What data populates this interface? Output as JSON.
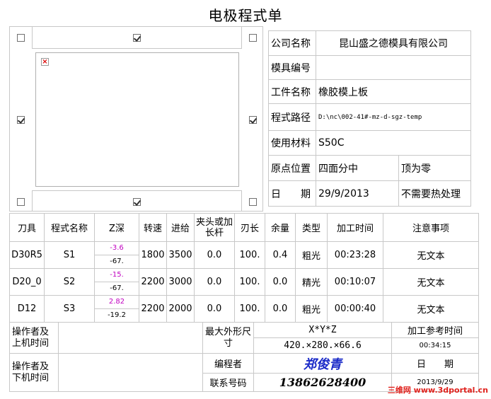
{
  "title": "电极程式单",
  "info": {
    "rows": [
      {
        "label": "公司名称",
        "value": "昆山盛之德模具有限公司"
      },
      {
        "label": "模具编号",
        "value": ""
      },
      {
        "label": "工件名称",
        "value": "橡胶模上板"
      },
      {
        "label": "程式路径",
        "value": "D:\\nc\\002-41#-mz-d-sgz-temp"
      },
      {
        "label": "使用材料",
        "value": "S50C"
      },
      {
        "label": "原点位置",
        "value": "四面分中",
        "extra": "顶为零"
      },
      {
        "label": "日　　期",
        "value": "29/9/2013",
        "extra": "不需要热处理"
      }
    ]
  },
  "headers": [
    "刀具",
    "程式名称",
    "Z深",
    "转速",
    "进给",
    "夹头或加长杆",
    "刃长",
    "余量",
    "类型",
    "加工时间",
    "注意事项"
  ],
  "rows": [
    {
      "tool": "D30R5",
      "prog": "S1",
      "z_top": "-3.6",
      "z_bot": "-67.",
      "speed": "1800",
      "feed": "3500",
      "chuck": "0.0",
      "blade": "100.",
      "allow": "0.4",
      "type": "粗光",
      "time": "00:23:28",
      "note": "无文本"
    },
    {
      "tool": "D20_0",
      "prog": "S2",
      "z_top": "-15.",
      "z_bot": "-67.",
      "speed": "2200",
      "feed": "3000",
      "chuck": "0.0",
      "blade": "100.",
      "allow": "0.0",
      "type": "精光",
      "time": "00:10:07",
      "note": "无文本"
    },
    {
      "tool": "D12",
      "prog": "S3",
      "z_top": "2.82",
      "z_bot": "-19.2",
      "speed": "2200",
      "feed": "2000",
      "chuck": "0.0",
      "blade": "100.",
      "allow": "0.0",
      "type": "粗光",
      "time": "00:00:40",
      "note": "无文本"
    }
  ],
  "bottom": {
    "operator_on": "操作者及上机时间",
    "operator_off": "操作者及下机时间",
    "max_size_label": "最大外形尺寸",
    "xyz_label": "X*Y*Z",
    "xyz_value": "420.×280.×66.6",
    "ref_time_label": "加工参考时间",
    "ref_time_value": "00:34:15",
    "programmer_label": "编程者",
    "programmer_value": "郑俊青",
    "date_label": "日　　期",
    "phone_label": "联系号码",
    "phone_value": "13862628400",
    "date_value": "2013/9/29"
  },
  "watermark": "三维网 www.3dportal.cn"
}
